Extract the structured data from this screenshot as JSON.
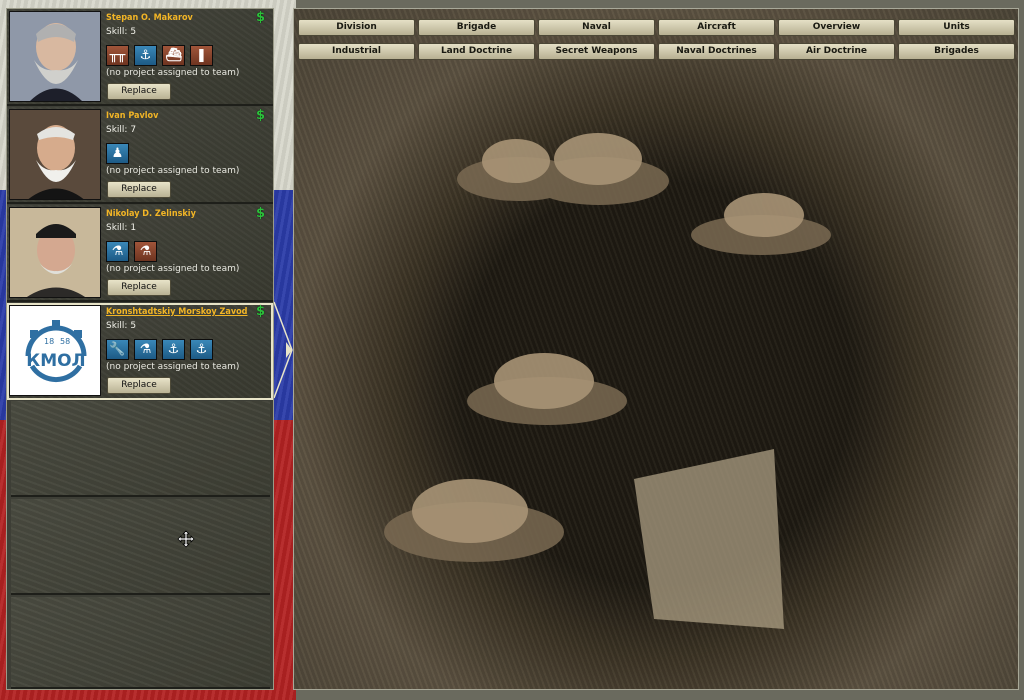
{
  "colors": {
    "name_color": "#f2b526",
    "funds_color": "#2bbf3a",
    "icon_brown": "#8a4a30",
    "icon_blue": "#2a76a8"
  },
  "teams": [
    {
      "name": "Stepan O. Makarov",
      "skill": "Skill: 5",
      "funds_icon": "$",
      "icons": [
        {
          "name": "naval-gun-icon",
          "glyph": "╥╥",
          "color": "brown"
        },
        {
          "name": "anchor-wrench-icon",
          "glyph": "⚓",
          "color": "blue"
        },
        {
          "name": "ship-hull-icon",
          "glyph": "⛴",
          "color": "brown"
        },
        {
          "name": "torpedo-icon",
          "glyph": "❚",
          "color": "brown"
        }
      ],
      "status": "(no project assigned to team)",
      "replace_label": "Replace"
    },
    {
      "name": "Ivan Pavlov",
      "skill": "Skill: 7",
      "funds_icon": "$",
      "icons": [
        {
          "name": "infantry-icon",
          "glyph": "♟",
          "color": "blue"
        }
      ],
      "status": "(no project assigned to team)",
      "replace_label": "Replace"
    },
    {
      "name": "Nikolay D. Zelinskiy",
      "skill": "Skill: 1",
      "funds_icon": "$",
      "icons": [
        {
          "name": "flask-icon",
          "glyph": "⚗",
          "color": "blue"
        },
        {
          "name": "chemistry-flask-icon",
          "glyph": "⚗",
          "color": "brown"
        }
      ],
      "status": "(no project assigned to team)",
      "replace_label": "Replace"
    },
    {
      "name": "Kronshtadtskiy Morskoy Zavod",
      "skill": "Skill: 5",
      "funds_icon": "$",
      "logo_text": "КМОЛ",
      "logo_year_left": "18",
      "logo_year_right": "58",
      "icons": [
        {
          "name": "wrench-icon",
          "glyph": "🔧",
          "color": "blue"
        },
        {
          "name": "flask-icon",
          "glyph": "⚗",
          "color": "blue"
        },
        {
          "name": "anchor-icon",
          "glyph": "⚓",
          "color": "blue"
        },
        {
          "name": "anchor-wrench-icon",
          "glyph": "⚓",
          "color": "blue"
        }
      ],
      "status": "(no project assigned to team)",
      "replace_label": "Replace"
    }
  ],
  "tabs_row1": [
    "Division",
    "Brigade",
    "Naval",
    "Aircraft",
    "Overview",
    "Units"
  ],
  "tabs_row2": [
    "Industrial",
    "Land Doctrine",
    "Secret Weapons",
    "Naval Doctrines",
    "Air Doctrine",
    "Brigades"
  ]
}
